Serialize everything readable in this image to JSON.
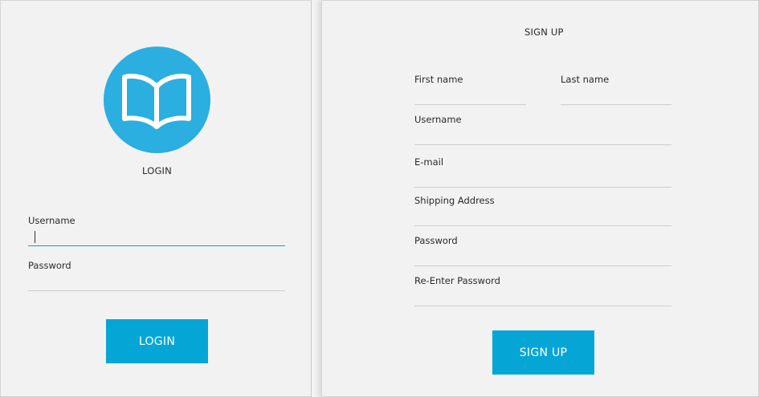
{
  "theme": {
    "accent": "#05a6d6",
    "logo_bg": "#2baee0",
    "focus_line": "#2a93c6"
  },
  "login": {
    "logo_icon": "open-book-icon",
    "title": "LOGIN",
    "username_label": "Username",
    "username_value": "",
    "password_label": "Password",
    "password_value": "",
    "submit_label": "LOGIN"
  },
  "signup": {
    "title": "SIGN UP",
    "first_name_label": "First name",
    "last_name_label": "Last name",
    "username_label": "Username",
    "email_label": "E-mail",
    "shipping_label": "Shipping Address",
    "password_label": "Password",
    "reenter_label": "Re-Enter Password",
    "submit_label": "SIGN UP"
  }
}
